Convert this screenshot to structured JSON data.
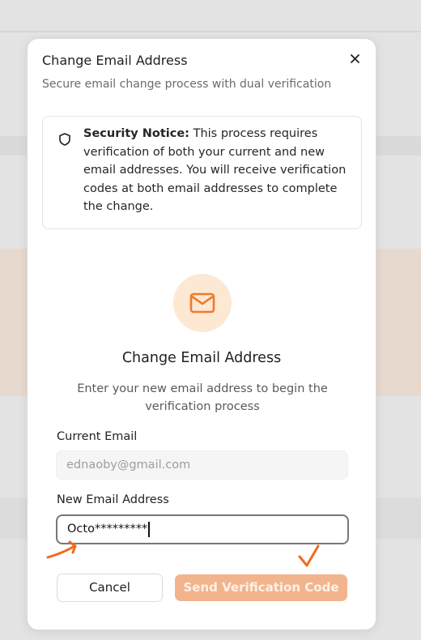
{
  "modal": {
    "title": "Change Email Address",
    "subtitle": "Secure email change process with dual verification",
    "close_icon": "close-icon"
  },
  "notice": {
    "icon": "shield-icon",
    "heading": "Security Notice:",
    "body": " This process requires verification of both your current and new email addresses. You will receive verification codes at both email addresses to complete the change."
  },
  "step": {
    "icon": "mail-icon",
    "title": "Change Email Address",
    "description": "Enter your new email address to begin the verification process"
  },
  "form": {
    "current_email_label": "Current Email",
    "current_email_value": "ednaoby@gmail.com",
    "new_email_label": "New Email Address",
    "new_email_value": "Octo*********"
  },
  "actions": {
    "cancel_label": "Cancel",
    "send_label": "Send Verification Code"
  },
  "colors": {
    "accent": "#f07a2a",
    "accent_light": "#fde8d4",
    "send_button_disabled": "#f2b48c",
    "annotation": "#f26a1b"
  }
}
